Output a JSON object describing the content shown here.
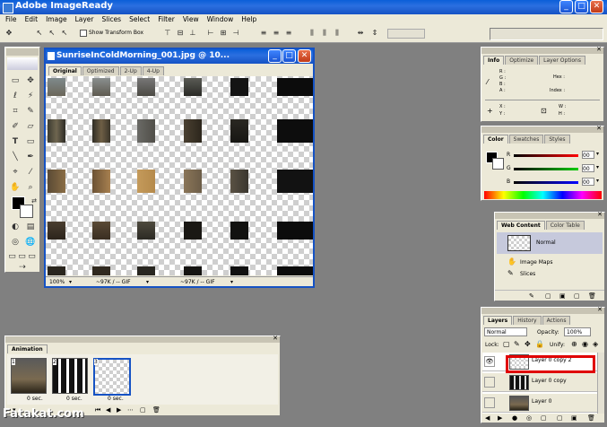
{
  "app": {
    "title": "Adobe ImageReady"
  },
  "menu": [
    "File",
    "Edit",
    "Image",
    "Layer",
    "Slices",
    "Select",
    "Filter",
    "View",
    "Window",
    "Help"
  ],
  "options_bar": {
    "show_transform_label": "Show Transform Box"
  },
  "document": {
    "title": "SunriseInColdMorning_001.jpg @ 10...",
    "tabs": [
      "Original",
      "Optimized",
      "2-Up",
      "4-Up"
    ],
    "active_tab": "Original",
    "zoom": "100%",
    "status1": "~97K / -- GIF",
    "status2": "~97K / -- GIF"
  },
  "info_panel": {
    "tabs": [
      "Info",
      "Optimize",
      "Layer Options"
    ],
    "labels": {
      "r": "R :",
      "g": "G :",
      "b": "B :",
      "a": "A :",
      "hex": "Hex :",
      "index": "Index :",
      "x": "X :",
      "y": "Y :",
      "w": "W :",
      "h": "H :"
    }
  },
  "color_panel": {
    "tabs": [
      "Color",
      "Swatches",
      "Styles"
    ],
    "r_label": "R",
    "g_label": "G",
    "b_label": "B",
    "r_value": "00",
    "g_value": "00",
    "b_value": "00"
  },
  "web_content_panel": {
    "tabs": [
      "Web Content",
      "Color Table"
    ],
    "items": [
      "Normal",
      "Image Maps",
      "Slices"
    ]
  },
  "animation_panel": {
    "tab": "Animation",
    "frames": [
      {
        "number": "1",
        "delay": "0 sec."
      },
      {
        "number": "2",
        "delay": "0 sec."
      },
      {
        "number": "3",
        "delay": "0 sec."
      }
    ]
  },
  "layers_panel": {
    "tabs": [
      "Layers",
      "History",
      "Actions"
    ],
    "blend_mode": "Normal",
    "opacity_label": "Opacity:",
    "opacity_value": "100%",
    "lock_label": "Lock:",
    "unify_label": "Unify:",
    "layers": [
      "Layer 0 copy 2",
      "Layer 0 copy",
      "Layer 0"
    ],
    "highlight_color": "#e00000"
  },
  "watermark": "Fatakat.com",
  "colors": {
    "xp_blue": "#1552c4",
    "workspace": "#808080",
    "panel": "#ece9d8"
  }
}
